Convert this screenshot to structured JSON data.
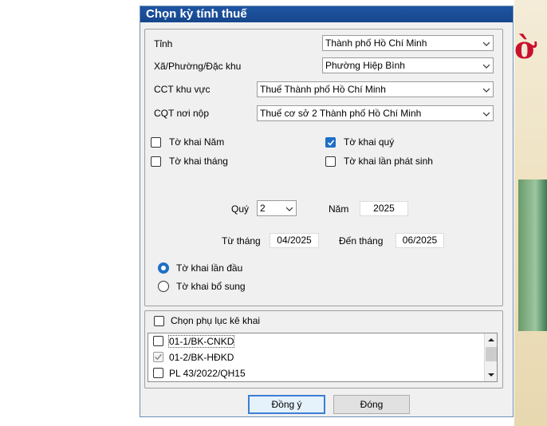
{
  "dialog": {
    "title": "Chọn kỳ tính thuế",
    "tinh": {
      "label": "Tỉnh",
      "value": "Thành phố Hồ Chí Minh"
    },
    "xa": {
      "label": "Xã/Phường/Đặc khu",
      "value": "Phường Hiệp Bình"
    },
    "cct": {
      "label": "CCT khu vực",
      "value": "Thuế Thành phố Hồ Chí Minh"
    },
    "cqt": {
      "label": "CQT nơi nộp",
      "value": "Thuế cơ sở 2 Thành phố Hồ Chí Minh"
    },
    "checkboxes": [
      {
        "label": "Tờ khai Năm",
        "checked": false
      },
      {
        "label": "Tờ khai quý",
        "checked": true
      },
      {
        "label": "Tờ khai tháng",
        "checked": false
      },
      {
        "label": "Tờ khai lần phát sinh",
        "checked": false
      }
    ],
    "quy": {
      "label": "Quý",
      "value": "2"
    },
    "nam": {
      "label": "Năm",
      "value": "2025"
    },
    "tu_thang": {
      "label": "Từ tháng",
      "value": "04/2025"
    },
    "den_thang": {
      "label": "Đến tháng",
      "value": "06/2025"
    },
    "radios": [
      {
        "label": "Tờ khai lần đầu",
        "selected": true
      },
      {
        "label": "Tờ khai bổ sung",
        "selected": false
      }
    ],
    "phu_luc": {
      "label": "Chọn phụ lục kê khai",
      "items": [
        {
          "label": "01-1/BK-CNKD",
          "checked": false,
          "disabled": false
        },
        {
          "label": "01-2/BK-HĐKD",
          "checked": true,
          "disabled": true
        },
        {
          "label": "PL 43/2022/QH15",
          "checked": false,
          "disabled": false
        }
      ]
    },
    "buttons": {
      "ok": "Đồng ý",
      "close": "Đóng"
    }
  },
  "colors": {
    "titlebar": "#1f55a3",
    "accent": "#1f6fc6",
    "brand_red": "#c8102e"
  }
}
